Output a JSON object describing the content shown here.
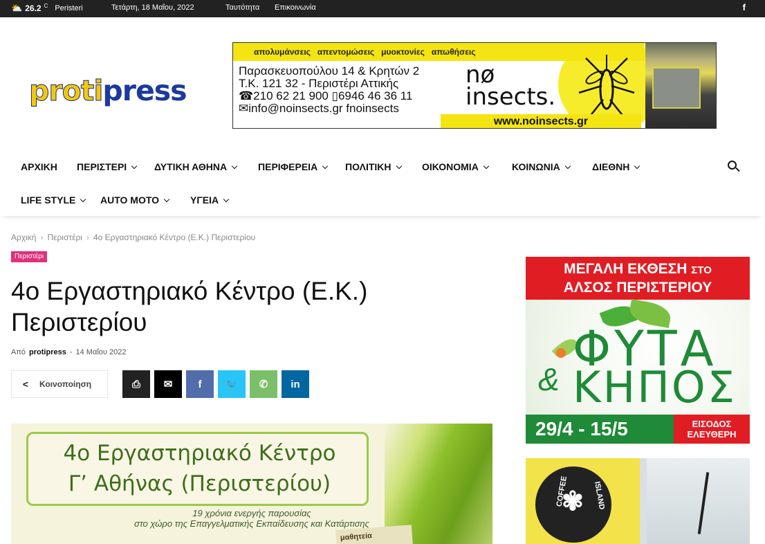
{
  "topbar": {
    "temperature": "26.2",
    "unit": "C",
    "city": "Peristeri",
    "date": "Τετάρτη, 18 Μαΐου, 2022",
    "links": [
      "Ταυτότητα",
      "Επικοινωνία"
    ],
    "social_icon": "facebook-icon"
  },
  "logo": {
    "part1": "proti",
    "part2": "press"
  },
  "header_ad": {
    "strip": [
      "απολυμάνσεις",
      "απεντομώσεις",
      "μυοκτονίες",
      "απωθήσεις"
    ],
    "address1": "Παρασκευοπούλου 14 & Κρητών 2",
    "address2": "Τ.Κ. 121 32 - Περιστέρι Αττικής",
    "phones": "☎210 62 21 900  ▯6946 46 36 11",
    "email": "✉info@noinsects.gr  fnoinsects",
    "brand_line1": "nø",
    "brand_line2": "insects.",
    "website": "www.noinsects.gr"
  },
  "nav": {
    "items": [
      {
        "label": "ΑΡΧΙΚΗ"
      },
      {
        "label": "ΠΕΡΙΣΤΕΡΙ"
      },
      {
        "label": "ΔΥΤΙΚΗ ΑΘΗΝΑ"
      },
      {
        "label": "ΠΕΡΙΦΕΡΕΙΑ"
      },
      {
        "label": "ΠΟΛΙΤΙΚΗ"
      },
      {
        "label": "ΟΙΚΟΝΟΜΙΑ"
      },
      {
        "label": "ΚΟΙΝΩΝΙΑ"
      },
      {
        "label": "ΔΙΕΘΝΗ"
      },
      {
        "label": "LIFE STYLE"
      },
      {
        "label": "AUTO MOTO"
      },
      {
        "label": "ΥΓΕΙΑ"
      }
    ]
  },
  "breadcrumb": [
    "Αρχική",
    "Περιστέρι",
    "4ο Εργαστηριακό Κέντρο (Ε.Κ.) Περιστερίου"
  ],
  "category": "Περιστέρι",
  "article": {
    "title_line1": "4ο Εργαστηριακό Κέντρο (Ε.Κ.)",
    "title_line2": "Περιστερίου",
    "by": "Από",
    "author": "protipress",
    "date": "14 Μαΐου 2022"
  },
  "share": {
    "label": "Κοινοποίηση",
    "buttons": [
      {
        "name": "print-icon",
        "color": "#222222",
        "glyph": "⎙"
      },
      {
        "name": "email-icon",
        "color": "#000000",
        "glyph": "✉"
      },
      {
        "name": "facebook-icon",
        "color": "#516eab",
        "glyph": "f"
      },
      {
        "name": "twitter-icon",
        "color": "#29c5f6",
        "glyph": "🐦"
      },
      {
        "name": "whatsapp-icon",
        "color": "#7bbf6a",
        "glyph": "✆"
      },
      {
        "name": "linkedin-icon",
        "color": "#0266a0",
        "glyph": "in"
      }
    ]
  },
  "featured": {
    "line1": "4ο Εργαστηριακό Κέντρο",
    "line2": "Γ’ Αθήνας (Περιστερίου)",
    "line3": "19 χρόνια ενεργής παρουσίας",
    "line4": "στο χώρο της Επαγγελματικής Εκπαίδευσης και Κατάρτισης",
    "book": "μαθητεία"
  },
  "side_ad1": {
    "line1": "ΜΕΓΑΛΗ ΕΚΘΕΣΗ",
    "line1b": "ΣΤΟ",
    "line2": "ΑΛΣΟΣ ΠΕΡΙΣΤΕΡΙΟΥ",
    "word1": "ΦΥΤΑ",
    "amp": "&",
    "word2": "ΚΗΠΟΣ",
    "dates": "29/4 - 15/5",
    "free1": "ΕΙΣΟΔΟΣ",
    "free2": "ΕΛΕΥΘΕΡΗ"
  },
  "side_ad2": {
    "t1": "COFFEE",
    "t2": "ISLAND"
  }
}
